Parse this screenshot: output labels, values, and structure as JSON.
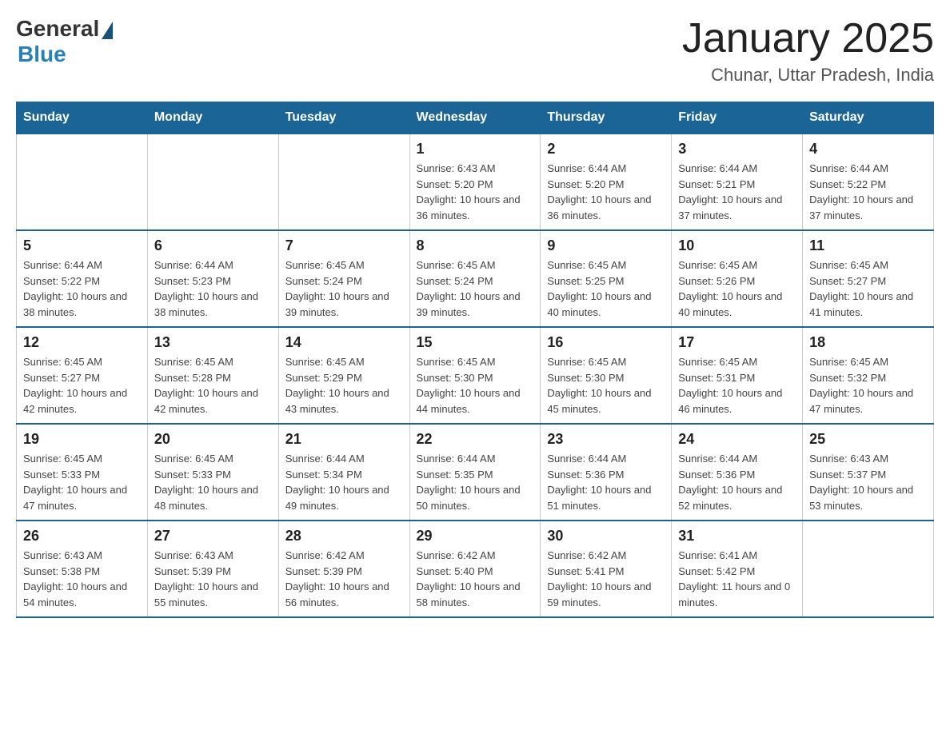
{
  "header": {
    "logo": {
      "general_text": "General",
      "blue_text": "Blue"
    },
    "title": "January 2025",
    "subtitle": "Chunar, Uttar Pradesh, India"
  },
  "days_of_week": [
    "Sunday",
    "Monday",
    "Tuesday",
    "Wednesday",
    "Thursday",
    "Friday",
    "Saturday"
  ],
  "weeks": [
    [
      {
        "day": "",
        "info": ""
      },
      {
        "day": "",
        "info": ""
      },
      {
        "day": "",
        "info": ""
      },
      {
        "day": "1",
        "info": "Sunrise: 6:43 AM\nSunset: 5:20 PM\nDaylight: 10 hours and 36 minutes."
      },
      {
        "day": "2",
        "info": "Sunrise: 6:44 AM\nSunset: 5:20 PM\nDaylight: 10 hours and 36 minutes."
      },
      {
        "day": "3",
        "info": "Sunrise: 6:44 AM\nSunset: 5:21 PM\nDaylight: 10 hours and 37 minutes."
      },
      {
        "day": "4",
        "info": "Sunrise: 6:44 AM\nSunset: 5:22 PM\nDaylight: 10 hours and 37 minutes."
      }
    ],
    [
      {
        "day": "5",
        "info": "Sunrise: 6:44 AM\nSunset: 5:22 PM\nDaylight: 10 hours and 38 minutes."
      },
      {
        "day": "6",
        "info": "Sunrise: 6:44 AM\nSunset: 5:23 PM\nDaylight: 10 hours and 38 minutes."
      },
      {
        "day": "7",
        "info": "Sunrise: 6:45 AM\nSunset: 5:24 PM\nDaylight: 10 hours and 39 minutes."
      },
      {
        "day": "8",
        "info": "Sunrise: 6:45 AM\nSunset: 5:24 PM\nDaylight: 10 hours and 39 minutes."
      },
      {
        "day": "9",
        "info": "Sunrise: 6:45 AM\nSunset: 5:25 PM\nDaylight: 10 hours and 40 minutes."
      },
      {
        "day": "10",
        "info": "Sunrise: 6:45 AM\nSunset: 5:26 PM\nDaylight: 10 hours and 40 minutes."
      },
      {
        "day": "11",
        "info": "Sunrise: 6:45 AM\nSunset: 5:27 PM\nDaylight: 10 hours and 41 minutes."
      }
    ],
    [
      {
        "day": "12",
        "info": "Sunrise: 6:45 AM\nSunset: 5:27 PM\nDaylight: 10 hours and 42 minutes."
      },
      {
        "day": "13",
        "info": "Sunrise: 6:45 AM\nSunset: 5:28 PM\nDaylight: 10 hours and 42 minutes."
      },
      {
        "day": "14",
        "info": "Sunrise: 6:45 AM\nSunset: 5:29 PM\nDaylight: 10 hours and 43 minutes."
      },
      {
        "day": "15",
        "info": "Sunrise: 6:45 AM\nSunset: 5:30 PM\nDaylight: 10 hours and 44 minutes."
      },
      {
        "day": "16",
        "info": "Sunrise: 6:45 AM\nSunset: 5:30 PM\nDaylight: 10 hours and 45 minutes."
      },
      {
        "day": "17",
        "info": "Sunrise: 6:45 AM\nSunset: 5:31 PM\nDaylight: 10 hours and 46 minutes."
      },
      {
        "day": "18",
        "info": "Sunrise: 6:45 AM\nSunset: 5:32 PM\nDaylight: 10 hours and 47 minutes."
      }
    ],
    [
      {
        "day": "19",
        "info": "Sunrise: 6:45 AM\nSunset: 5:33 PM\nDaylight: 10 hours and 47 minutes."
      },
      {
        "day": "20",
        "info": "Sunrise: 6:45 AM\nSunset: 5:33 PM\nDaylight: 10 hours and 48 minutes."
      },
      {
        "day": "21",
        "info": "Sunrise: 6:44 AM\nSunset: 5:34 PM\nDaylight: 10 hours and 49 minutes."
      },
      {
        "day": "22",
        "info": "Sunrise: 6:44 AM\nSunset: 5:35 PM\nDaylight: 10 hours and 50 minutes."
      },
      {
        "day": "23",
        "info": "Sunrise: 6:44 AM\nSunset: 5:36 PM\nDaylight: 10 hours and 51 minutes."
      },
      {
        "day": "24",
        "info": "Sunrise: 6:44 AM\nSunset: 5:36 PM\nDaylight: 10 hours and 52 minutes."
      },
      {
        "day": "25",
        "info": "Sunrise: 6:43 AM\nSunset: 5:37 PM\nDaylight: 10 hours and 53 minutes."
      }
    ],
    [
      {
        "day": "26",
        "info": "Sunrise: 6:43 AM\nSunset: 5:38 PM\nDaylight: 10 hours and 54 minutes."
      },
      {
        "day": "27",
        "info": "Sunrise: 6:43 AM\nSunset: 5:39 PM\nDaylight: 10 hours and 55 minutes."
      },
      {
        "day": "28",
        "info": "Sunrise: 6:42 AM\nSunset: 5:39 PM\nDaylight: 10 hours and 56 minutes."
      },
      {
        "day": "29",
        "info": "Sunrise: 6:42 AM\nSunset: 5:40 PM\nDaylight: 10 hours and 58 minutes."
      },
      {
        "day": "30",
        "info": "Sunrise: 6:42 AM\nSunset: 5:41 PM\nDaylight: 10 hours and 59 minutes."
      },
      {
        "day": "31",
        "info": "Sunrise: 6:41 AM\nSunset: 5:42 PM\nDaylight: 11 hours and 0 minutes."
      },
      {
        "day": "",
        "info": ""
      }
    ]
  ]
}
